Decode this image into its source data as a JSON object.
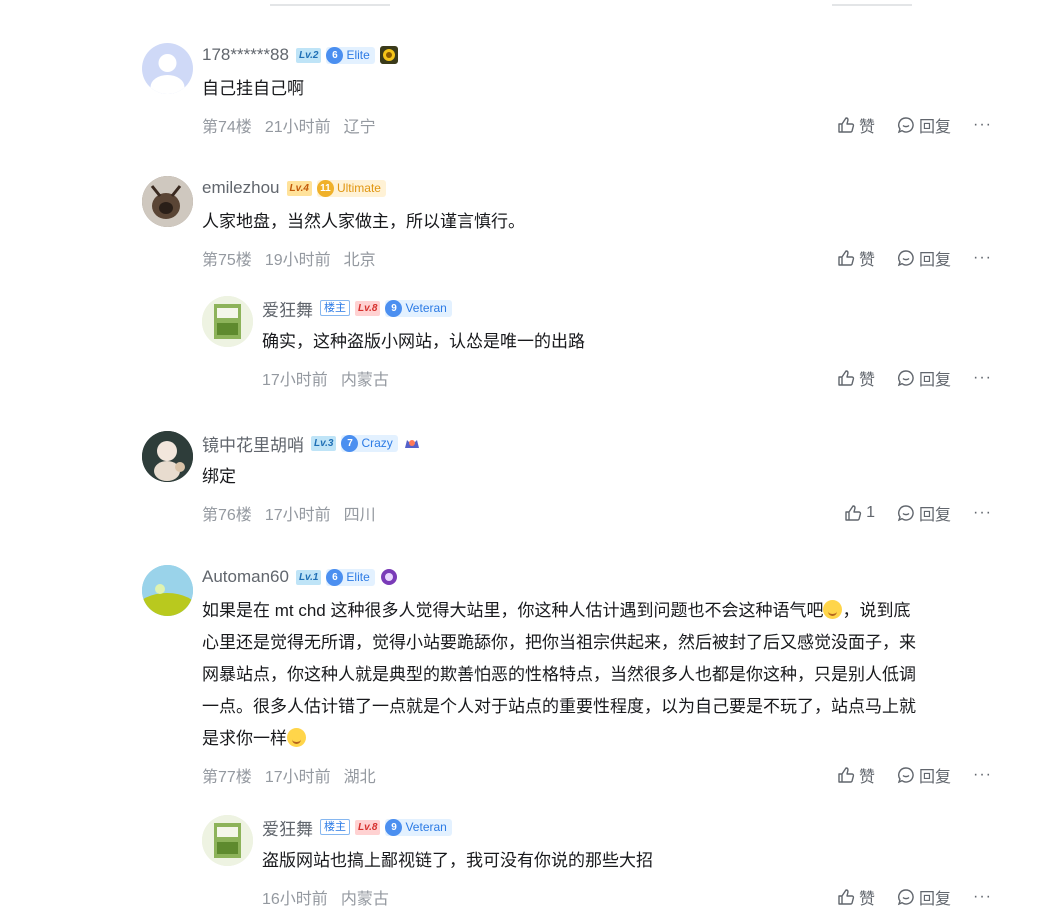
{
  "comments": [
    {
      "user": "178******88",
      "level": "Lv.2",
      "medal_num": "6",
      "medal_name": "Elite",
      "text": "自己挂自己啊",
      "floor": "第74楼",
      "time": "21小时前",
      "location": "辽宁",
      "like": "赞",
      "reply": "回复",
      "more": "···"
    },
    {
      "user": "emilezhou",
      "level": "Lv.4",
      "medal_num": "11",
      "medal_name": "Ultimate",
      "text": "人家地盘，当然人家做主，所以谨言慎行。",
      "floor": "第75楼",
      "time": "19小时前",
      "location": "北京",
      "like": "赞",
      "reply": "回复",
      "more": "···"
    },
    {
      "user": "镜中花里胡哨",
      "level": "Lv.3",
      "medal_num": "7",
      "medal_name": "Crazy",
      "text": "绑定",
      "floor": "第76楼",
      "time": "17小时前",
      "location": "四川",
      "like": "1",
      "reply": "回复",
      "more": "···"
    },
    {
      "user": "Automan60",
      "level": "Lv.1",
      "medal_num": "6",
      "medal_name": "Elite",
      "text_lines": [
        "如果是在 mt chd 这种很多人觉得大站里，你这种人估计遇到问题也不会这种语气吧",
        "，说到底",
        "心里还是觉得无所谓，觉得小站要跪舔你，把你当祖宗供起来，然后被封了后又感觉没面子，来",
        "网暴站点，你这种人就是典型的欺善怕恶的性格特点，当然很多人也都是你这种，只是别人低调",
        "一点。很多人估计错了一点就是个人对于站点的重要性程度，以为自己要是不玩了，站点马上就",
        "是求你一样"
      ],
      "floor": "第77楼",
      "time": "17小时前",
      "location": "湖北",
      "like": "赞",
      "reply": "回复",
      "more": "···"
    }
  ],
  "replies": [
    {
      "user": "爱狂舞",
      "host_badge": "楼主",
      "level": "Lv.8",
      "medal_num": "9",
      "medal_name": "Veteran",
      "text": "确实，这种盗版小网站，认怂是唯一的出路",
      "time": "17小时前",
      "location": "内蒙古",
      "like": "赞",
      "reply": "回复",
      "more": "···"
    },
    {
      "user": "爱狂舞",
      "host_badge": "楼主",
      "level": "Lv.8",
      "medal_num": "9",
      "medal_name": "Veteran",
      "text": "盗版网站也搞上鄙视链了，我可没有你说的那些大招",
      "time": "16小时前",
      "location": "内蒙古",
      "like": "赞",
      "reply": "回复",
      "more": "···"
    }
  ]
}
